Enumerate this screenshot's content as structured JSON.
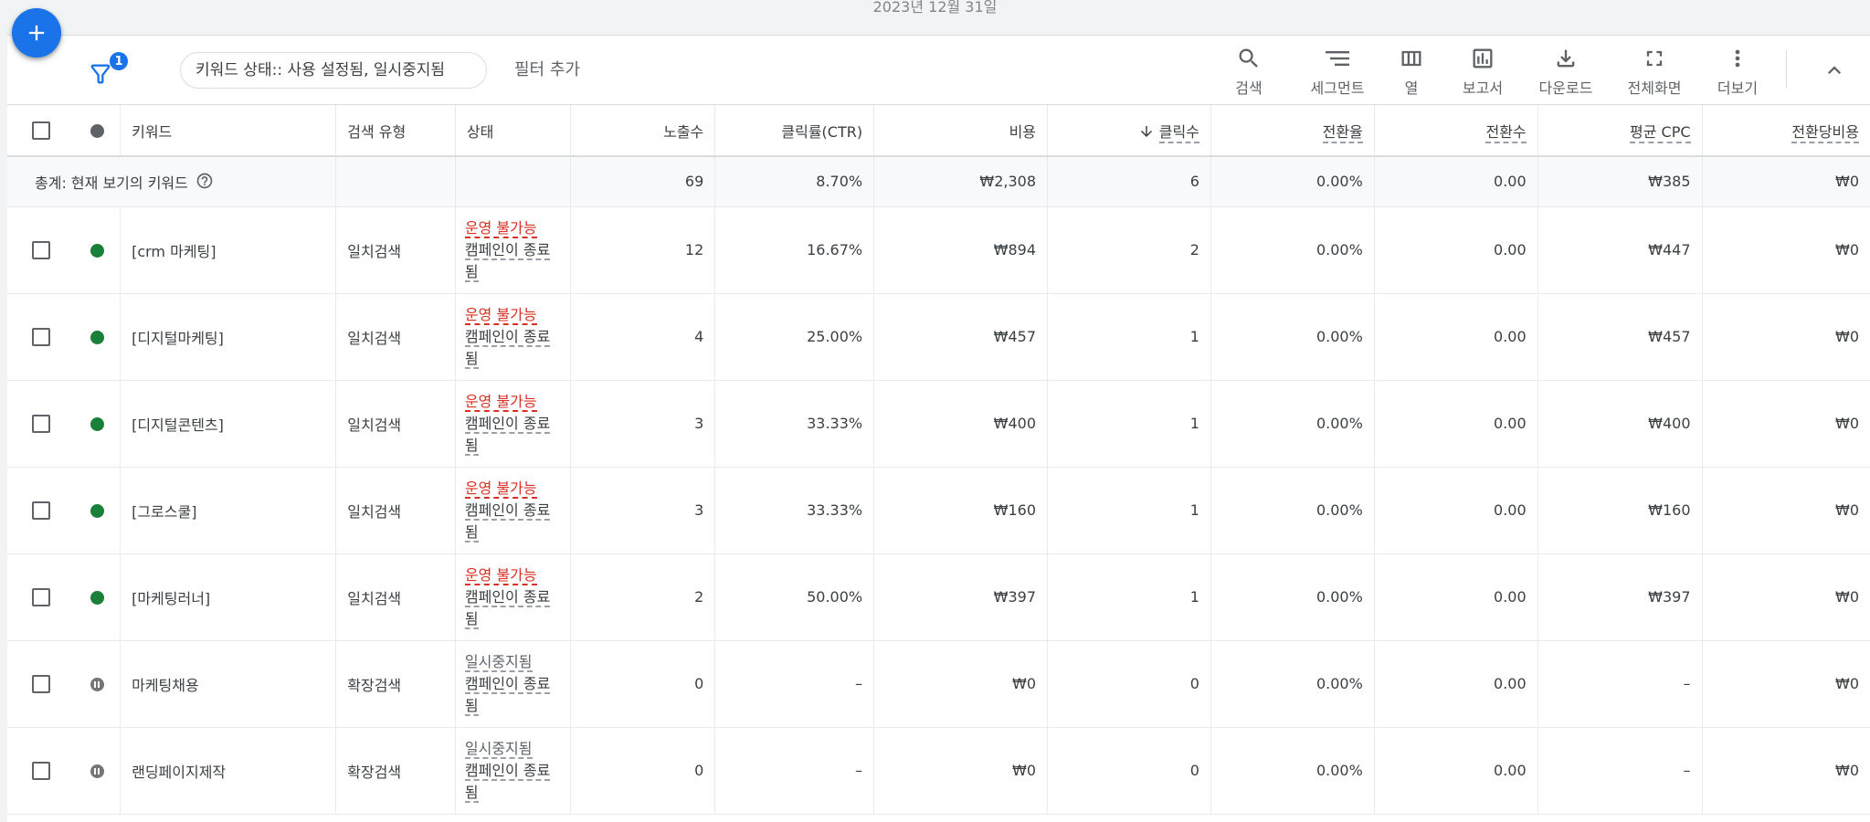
{
  "header": {
    "date_text": "2023년 12월 31일"
  },
  "fab": {
    "icon": "plus-icon"
  },
  "toolbar": {
    "filter_count": "1",
    "filter_chip": "키워드 상태:: 사용 설정됨, 일시중지됨",
    "add_filter": "필터 추가",
    "tools": [
      {
        "icon": "search-icon",
        "label": "검색"
      },
      {
        "icon": "segment-icon",
        "label": "세그먼트"
      },
      {
        "icon": "columns-icon",
        "label": "열"
      },
      {
        "icon": "report-icon",
        "label": "보고서"
      },
      {
        "icon": "download-icon",
        "label": "다운로드"
      },
      {
        "icon": "fullscreen-icon",
        "label": "전체화면"
      },
      {
        "icon": "more-vert-icon",
        "label": "더보기"
      }
    ]
  },
  "table": {
    "columns": {
      "keyword": "키워드",
      "match_type": "검색 유형",
      "status": "상태",
      "impressions": "노출수",
      "ctr": "클릭률(CTR)",
      "cost": "비용",
      "clicks": "클릭수",
      "conv_rate": "전환율",
      "conversions": "전환수",
      "avg_cpc": "평균 CPC",
      "cost_per_conv": "전환당비용"
    },
    "sort": {
      "column": "clicks",
      "direction": "descending",
      "icon": "arrow-down-icon"
    },
    "total": {
      "label": "총계: 현재 보기의 키워드",
      "impressions": "69",
      "ctr": "8.70%",
      "cost": "₩2,308",
      "clicks": "6",
      "conv_rate": "0.00%",
      "conversions": "0.00",
      "avg_cpc": "₩385",
      "cost_per_conv": "₩0"
    },
    "rows": [
      {
        "status_dot": "green",
        "keyword": "[crm 마케팅]",
        "match_type": "일치검색",
        "status_line1": "운영 불가능",
        "status_line2": "캠페인이 종료됨",
        "impressions": "12",
        "ctr": "16.67%",
        "cost": "₩894",
        "clicks": "2",
        "conv_rate": "0.00%",
        "conversions": "0.00",
        "avg_cpc": "₩447",
        "cost_per_conv": "₩0"
      },
      {
        "status_dot": "green",
        "keyword": "[디지털마케팅]",
        "match_type": "일치검색",
        "status_line1": "운영 불가능",
        "status_line2": "캠페인이 종료됨",
        "impressions": "4",
        "ctr": "25.00%",
        "cost": "₩457",
        "clicks": "1",
        "conv_rate": "0.00%",
        "conversions": "0.00",
        "avg_cpc": "₩457",
        "cost_per_conv": "₩0"
      },
      {
        "status_dot": "green",
        "keyword": "[디지털콘텐츠]",
        "match_type": "일치검색",
        "status_line1": "운영 불가능",
        "status_line2": "캠페인이 종료됨",
        "impressions": "3",
        "ctr": "33.33%",
        "cost": "₩400",
        "clicks": "1",
        "conv_rate": "0.00%",
        "conversions": "0.00",
        "avg_cpc": "₩400",
        "cost_per_conv": "₩0"
      },
      {
        "status_dot": "green",
        "keyword": "[그로스쿨]",
        "match_type": "일치검색",
        "status_line1": "운영 불가능",
        "status_line2": "캠페인이 종료됨",
        "impressions": "3",
        "ctr": "33.33%",
        "cost": "₩160",
        "clicks": "1",
        "conv_rate": "0.00%",
        "conversions": "0.00",
        "avg_cpc": "₩160",
        "cost_per_conv": "₩0"
      },
      {
        "status_dot": "green",
        "keyword": "[마케팅러너]",
        "match_type": "일치검색",
        "status_line1": "운영 불가능",
        "status_line2": "캠페인이 종료됨",
        "impressions": "2",
        "ctr": "50.00%",
        "cost": "₩397",
        "clicks": "1",
        "conv_rate": "0.00%",
        "conversions": "0.00",
        "avg_cpc": "₩397",
        "cost_per_conv": "₩0"
      },
      {
        "status_dot": "paused",
        "keyword": "마케팅채용",
        "match_type": "확장검색",
        "status_line1": "일시중지됨",
        "status_line2": "캠페인이 종료됨",
        "impressions": "0",
        "ctr": "–",
        "cost": "₩0",
        "clicks": "0",
        "conv_rate": "0.00%",
        "conversions": "0.00",
        "avg_cpc": "–",
        "cost_per_conv": "₩0"
      },
      {
        "status_dot": "paused",
        "keyword": "랜딩페이지제작",
        "match_type": "확장검색",
        "status_line1": "일시중지됨",
        "status_line2": "캠페인이 종료됨",
        "impressions": "0",
        "ctr": "–",
        "cost": "₩0",
        "clicks": "0",
        "conv_rate": "0.00%",
        "conversions": "0.00",
        "avg_cpc": "–",
        "cost_per_conv": "₩0"
      }
    ]
  },
  "colors": {
    "accent": "#1a73e8",
    "enabled": "#188038",
    "error": "#d93025",
    "paused": "#757575"
  }
}
